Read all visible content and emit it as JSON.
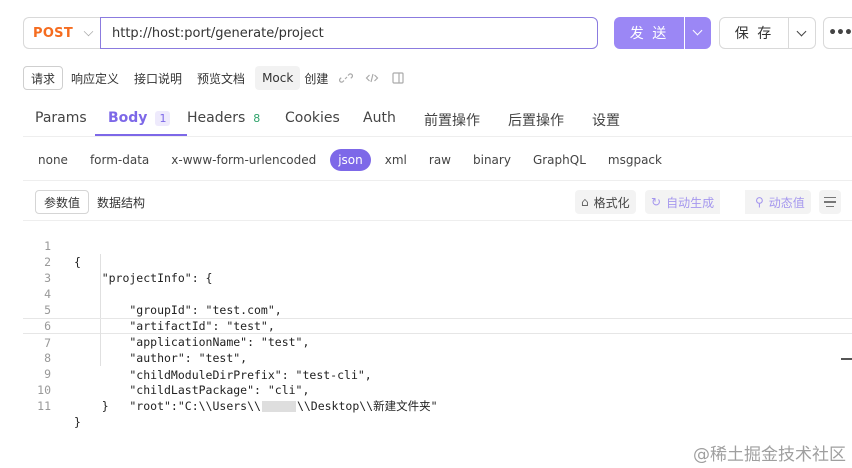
{
  "request": {
    "method": "POST",
    "url": "http://host:port/generate/project",
    "send_label": "发 送",
    "save_label": "保 存",
    "more_label": "•••"
  },
  "subbar": {
    "tabs": [
      "请求",
      "响应定义",
      "接口说明",
      "预览文档",
      "Mock"
    ],
    "create_label": "创建"
  },
  "request_tabs": [
    {
      "label": "Params",
      "count": ""
    },
    {
      "label": "Body",
      "count": "1"
    },
    {
      "label": "Headers",
      "count": "8"
    },
    {
      "label": "Cookies",
      "count": ""
    },
    {
      "label": "Auth",
      "count": ""
    },
    {
      "label": "前置操作",
      "count": ""
    },
    {
      "label": "后置操作",
      "count": ""
    },
    {
      "label": "设置",
      "count": ""
    }
  ],
  "body_types": [
    "none",
    "form-data",
    "x-www-form-urlencoded",
    "json",
    "xml",
    "raw",
    "binary",
    "GraphQL",
    "msgpack"
  ],
  "body_type_selected": "json",
  "panel": {
    "tabs": [
      "参数值",
      "数据结构"
    ],
    "format_label": "格式化",
    "autogen_label": "自动生成",
    "dynamic_label": "动态值"
  },
  "code_lines": [
    "{",
    "    \"projectInfo\": {",
    "        \"groupId\": \"test.com\",",
    "        \"artifactId\": \"test\",",
    "        \"applicationName\": \"test\",",
    "        \"author\": \"test\",",
    "        \"childModuleDirPrefix\": \"test-cli\",",
    "        \"childLastPackage\": \"cli\",",
    "        \"root\":\"C:\\\\Users\\\\",
    "    }",
    "}"
  ],
  "root_line_suffix": "\\\\Desktop\\\\新建文件夹\"",
  "watermark": "@稀土掘金技术社区",
  "colors": {
    "accent": "#7d68e8",
    "send_button": "#9b87f5",
    "method": "#f56c1f",
    "count_green": "#2fa36b"
  }
}
